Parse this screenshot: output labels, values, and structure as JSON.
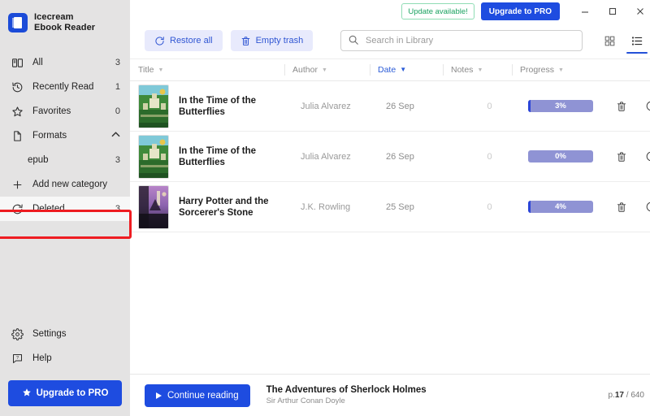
{
  "app": {
    "name_line1": "Icecream",
    "name_line2": "Ebook Reader",
    "logo_icon": "book-logo-icon"
  },
  "titlebar": {
    "update_label": "Update available!",
    "upgrade_label": "Upgrade to PRO",
    "minimize_icon": "minimize-icon",
    "maximize_icon": "maximize-icon",
    "close_icon": "close-icon"
  },
  "sidebar": {
    "items": [
      {
        "label": "All",
        "count": "3",
        "icon": "book-open-icon"
      },
      {
        "label": "Recently Read",
        "count": "1",
        "icon": "history-clock-icon"
      },
      {
        "label": "Favorites",
        "count": "0",
        "icon": "star-outline-icon"
      },
      {
        "label": "Formats",
        "count": "",
        "icon": "file-icon",
        "chevron": "chevron-up-icon"
      },
      {
        "label": "epub",
        "count": "3",
        "icon": ""
      },
      {
        "label": "Add new category",
        "count": "",
        "icon": "plus-icon"
      },
      {
        "label": "Deleted",
        "count": "3",
        "icon": "restore-icon"
      }
    ],
    "settings_label": "Settings",
    "settings_icon": "gear-icon",
    "help_label": "Help",
    "help_icon": "help-icon",
    "upgrade_label": "Upgrade to PRO",
    "upgrade_icon": "star-icon",
    "highlight_color": "#ee1c21"
  },
  "toolbar": {
    "restore_all_label": "Restore all",
    "restore_all_icon": "restore-icon",
    "empty_trash_label": "Empty trash",
    "empty_trash_icon": "trash-icon",
    "search_placeholder": "Search in Library",
    "search_value": "",
    "search_icon": "search-icon",
    "grid_view_icon": "grid-view-icon",
    "list_view_icon": "list-view-icon",
    "active_view": "list"
  },
  "table": {
    "columns": [
      {
        "key": "title",
        "label": "Title",
        "sorted": false
      },
      {
        "key": "author",
        "label": "Author",
        "sorted": false
      },
      {
        "key": "date",
        "label": "Date",
        "sorted": true
      },
      {
        "key": "notes",
        "label": "Notes",
        "sorted": false
      },
      {
        "key": "progress",
        "label": "Progress",
        "sorted": false
      }
    ],
    "rows": [
      {
        "title": "In the Time of the Butterflies",
        "author": "Julia Alvarez",
        "date": "26 Sep",
        "notes": "0",
        "progress": "3%",
        "progress_value": 3,
        "cover": "green-landscape-cover"
      },
      {
        "title": "In the Time of the Butterflies",
        "author": "Julia Alvarez",
        "date": "26 Sep",
        "notes": "0",
        "progress": "0%",
        "progress_value": 0,
        "cover": "green-landscape-cover"
      },
      {
        "title": "Harry Potter and the Sorcerer's Stone",
        "author": "J.K. Rowling",
        "date": "25 Sep",
        "notes": "0",
        "progress": "4%",
        "progress_value": 4,
        "cover": "purple-dark-cover"
      }
    ],
    "row_delete_icon": "trash-icon",
    "row_restore_icon": "restore-icon"
  },
  "player": {
    "continue_label": "Continue reading",
    "play_icon": "play-icon",
    "book_title": "The Adventures of Sherlock Holmes",
    "book_author": "Sir Arthur Conan Doyle",
    "page_prefix": "p.",
    "page_current": "17",
    "page_sep": " / ",
    "page_total": "640"
  },
  "colors": {
    "accent": "#1e4ce0",
    "soft_accent": "#e8eafc",
    "progress_track": "#8f93d4",
    "progress_fill": "#2b45d8",
    "sidebar_bg": "#e4e3e3",
    "update_green": "#1aa260",
    "highlight_red": "#ee1c21"
  }
}
